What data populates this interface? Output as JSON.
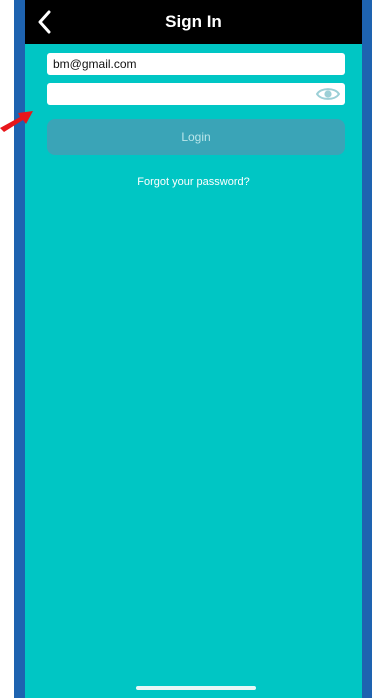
{
  "header": {
    "title": "Sign In",
    "back_icon": "chevron-left-icon"
  },
  "form": {
    "email_value": "bm@gmail.com",
    "password_value": "",
    "show_password_icon": "eye-icon",
    "login_label": "Login",
    "forgot_label": "Forgot your password?"
  },
  "colors": {
    "screen_background": "#00c6c4",
    "header_background": "#000000",
    "login_button": "#3aa4b7",
    "edge_blue": "#1e63b0",
    "annotation_arrow": "#e8161b"
  }
}
